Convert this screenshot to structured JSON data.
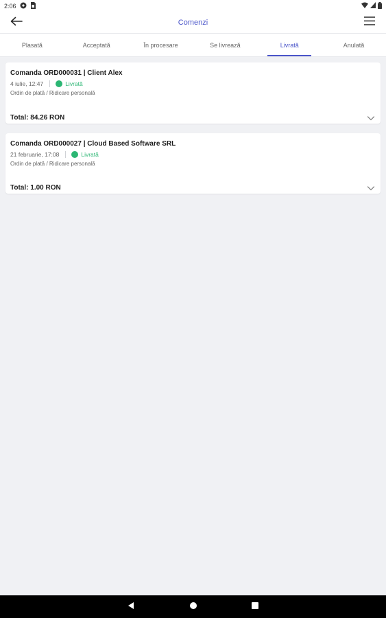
{
  "status_bar": {
    "time": "2:06",
    "icons": [
      "app-notification-icon",
      "sim-card-icon",
      "wifi-icon",
      "signal-icon",
      "battery-icon"
    ]
  },
  "app_bar": {
    "title": "Comenzi",
    "back_icon": "arrow-left-icon",
    "menu_icon": "hamburger-menu-icon"
  },
  "tabs": [
    {
      "label": "Plasată",
      "active": false
    },
    {
      "label": "Acceptată",
      "active": false
    },
    {
      "label": "În procesare",
      "active": false
    },
    {
      "label": "Se livrează",
      "active": false
    },
    {
      "label": "Livrată",
      "active": true
    },
    {
      "label": "Anulată",
      "active": false
    }
  ],
  "orders": [
    {
      "title": "Comanda ORD000031 | Client Alex",
      "date": "4 iulie, 12:47",
      "status": "Livrată",
      "payment": "Ordin de plată / Ridicare personală",
      "total": "Total: 84.26 RON"
    },
    {
      "title": "Comanda ORD000027 | Cloud Based Software SRL",
      "date": "21 februarie, 17:08",
      "status": "Livrată",
      "payment": "Ordin de plată / Ridicare personală",
      "total": "Total: 1.00 RON"
    }
  ],
  "colors": {
    "accent": "#4a55c9",
    "status_delivered": "#2bb673",
    "background": "#f0f1f4"
  },
  "nav_bar": {
    "icons": [
      "back-triangle-icon",
      "home-circle-icon",
      "recents-square-icon"
    ]
  }
}
